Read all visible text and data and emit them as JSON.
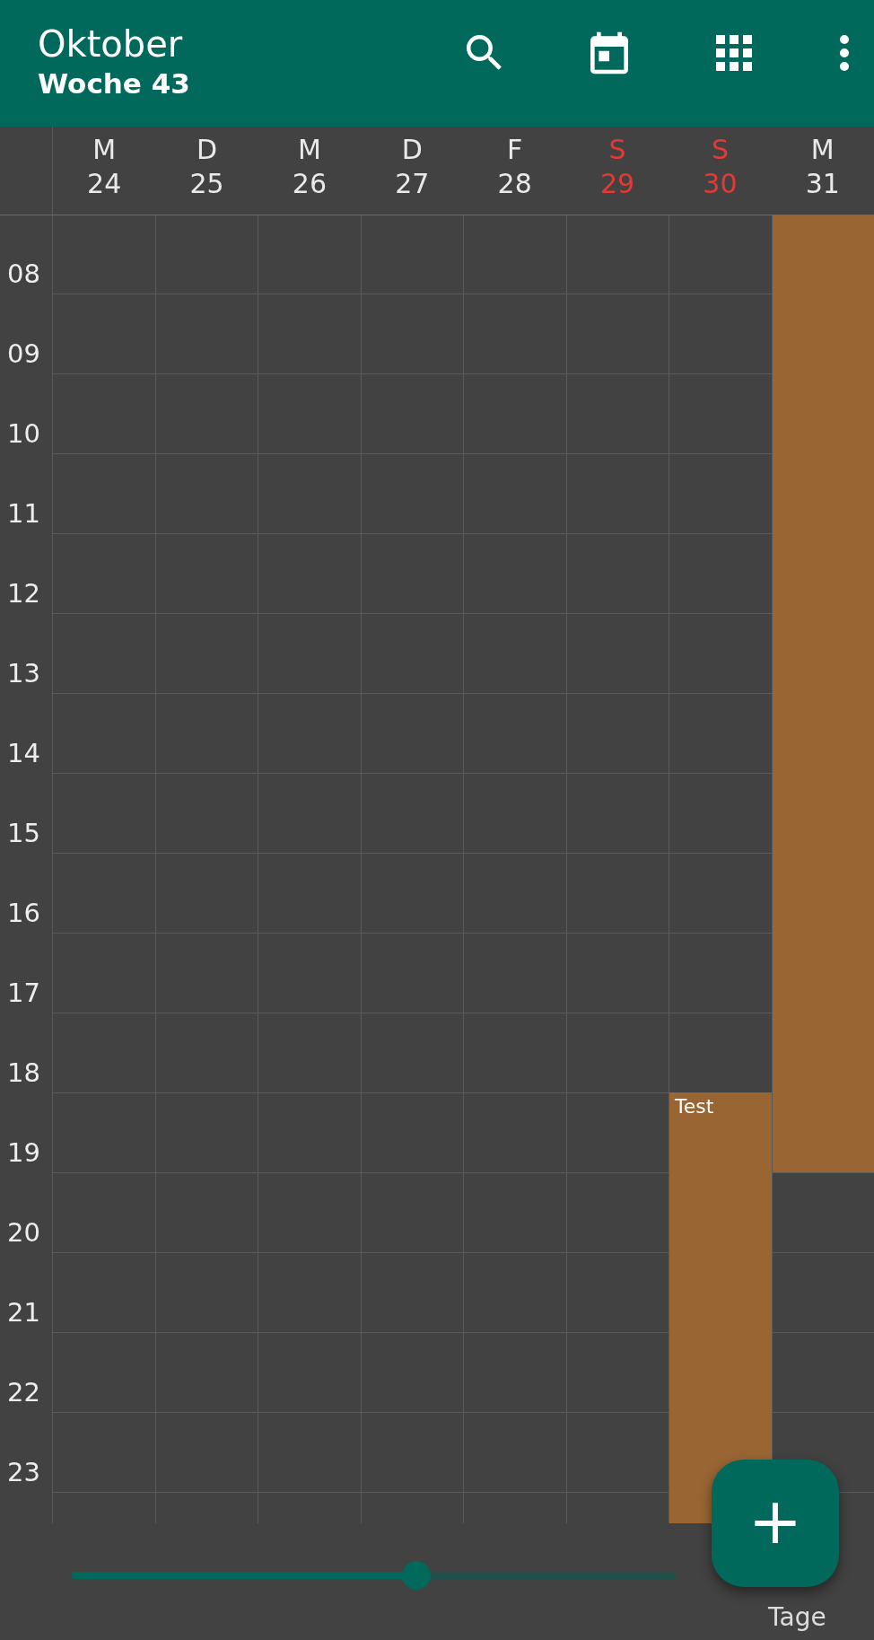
{
  "toolbar": {
    "title": "Oktober",
    "subtitle": "Woche 43"
  },
  "days": [
    {
      "weekday": "M",
      "date": "24",
      "weekend": false
    },
    {
      "weekday": "D",
      "date": "25",
      "weekend": false
    },
    {
      "weekday": "M",
      "date": "26",
      "weekend": false
    },
    {
      "weekday": "D",
      "date": "27",
      "weekend": false
    },
    {
      "weekday": "F",
      "date": "28",
      "weekend": false
    },
    {
      "weekday": "S",
      "date": "29",
      "weekend": true
    },
    {
      "weekday": "S",
      "date": "30",
      "weekend": true,
      "events": [
        {
          "kind": "titled",
          "title": "Test"
        }
      ]
    },
    {
      "weekday": "M",
      "date": "31",
      "weekend": false,
      "events": [
        {
          "kind": "untitled"
        }
      ]
    }
  ],
  "hours": [
    "08",
    "09",
    "10",
    "11",
    "12",
    "13",
    "14",
    "15",
    "16",
    "17",
    "18",
    "19",
    "20",
    "21",
    "22",
    "23"
  ],
  "zoom": {
    "level": 0.57,
    "label": "Tage"
  },
  "fab": {
    "symbol": "+"
  }
}
